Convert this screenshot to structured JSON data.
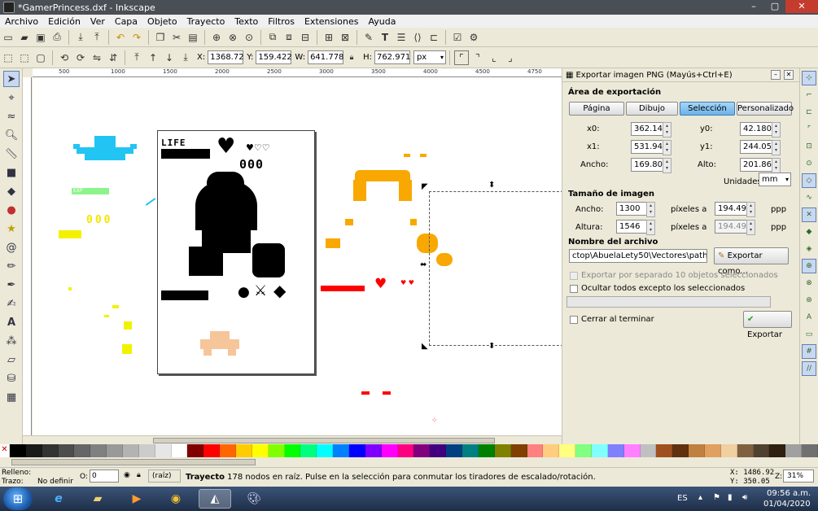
{
  "window": {
    "title": "*GamerPrincess.dxf - Inkscape"
  },
  "menu": [
    "Archivo",
    "Edición",
    "Ver",
    "Capa",
    "Objeto",
    "Trayecto",
    "Texto",
    "Filtros",
    "Extensiones",
    "Ayuda"
  ],
  "select_toolbar": {
    "x_label": "X:",
    "x": "1368.72",
    "y_label": "Y:",
    "y": "159.422",
    "w_label": "W:",
    "w": "641.778",
    "h_label": "H:",
    "h": "762.971",
    "unit": "px"
  },
  "ruler_ticks": [
    "500",
    "1000",
    "1500",
    "2000",
    "2500",
    "3000",
    "3500",
    "4000",
    "4500",
    "4750"
  ],
  "canvas": {
    "life_label": "LIFE",
    "exp_label": "EXP"
  },
  "export_dialog": {
    "header": "Exportar imagen PNG (Mayús+Ctrl+E)",
    "area_title": "Área de exportación",
    "area_buttons": [
      "Página",
      "Dibujo",
      "Selección",
      "Personalizado"
    ],
    "active_area": "Selección",
    "x0_label": "x0:",
    "x0": "362.143",
    "y0_label": "y0:",
    "y0": "42.180",
    "x1_label": "x1:",
    "x1": "531.947",
    "y1_label": "y1:",
    "y1": "244.050",
    "width_label": "Ancho:",
    "width": "169.804",
    "height_label": "Alto:",
    "height": "201.869",
    "units_label": "Unidades:",
    "units": "mm",
    "size_title": "Tamaño de imagen",
    "img_width_label": "Ancho:",
    "img_width": "1300",
    "img_height_label": "Altura:",
    "img_height": "1546",
    "pixels_at": "píxeles a",
    "dpi_x": "194.49",
    "dpi_y": "194.49",
    "dpi_unit": "ppp",
    "filename_title": "Nombre del archivo",
    "filename": "ctop\\AbuelaLety50\\Vectores\\path22.png",
    "export_as": "Exportar como...",
    "batch_label": "Exportar por separado 10 objetos seleccionados",
    "hide_label": "Ocultar todos excepto los seleccionados",
    "close_label": "Cerrar al terminar",
    "export_button": "Exportar"
  },
  "palette": [
    "#000000",
    "#1a1a1a",
    "#333333",
    "#4d4d4d",
    "#666666",
    "#808080",
    "#999999",
    "#b3b3b3",
    "#cccccc",
    "#e6e6e6",
    "#ffffff",
    "#800000",
    "#ff0000",
    "#ff6600",
    "#ffcc00",
    "#ffff00",
    "#80ff00",
    "#00ff00",
    "#00ff80",
    "#00ffff",
    "#0080ff",
    "#0000ff",
    "#8000ff",
    "#ff00ff",
    "#ff0080",
    "#800080",
    "#400080",
    "#004080",
    "#008080",
    "#008000",
    "#808000",
    "#804000",
    "#ff8080",
    "#ffcc80",
    "#ffff80",
    "#80ff80",
    "#80ffff",
    "#8080ff",
    "#ff80ff",
    "#c0c0c0",
    "#a05020",
    "#603010",
    "#c08040",
    "#e0a060",
    "#f0d0a0",
    "#806040",
    "#504030",
    "#302010",
    "#a0a0a0",
    "#707070"
  ],
  "status": {
    "fill_label": "Relleno:",
    "stroke_label": "Trazo:",
    "stroke_value": "No definir",
    "opacity_label": "O:",
    "opacity": "0",
    "layer": "(raíz)",
    "message_bold": "Trayecto",
    "message": " 178 nodos en raíz. Pulse en la selección para conmutar los tiradores de escalado/rotación.",
    "cursor_x": "X: 1486.92",
    "cursor_y": "Y:  350.05",
    "zoom_label": "Z:",
    "zoom": "31%"
  },
  "taskbar": {
    "lang": "ES",
    "time": "09:56 a.m.",
    "date": "01/04/2020"
  },
  "colors": {
    "accent": "#6cb2ea",
    "titlebar": "#4a4e55",
    "close": "#c43c2e"
  }
}
